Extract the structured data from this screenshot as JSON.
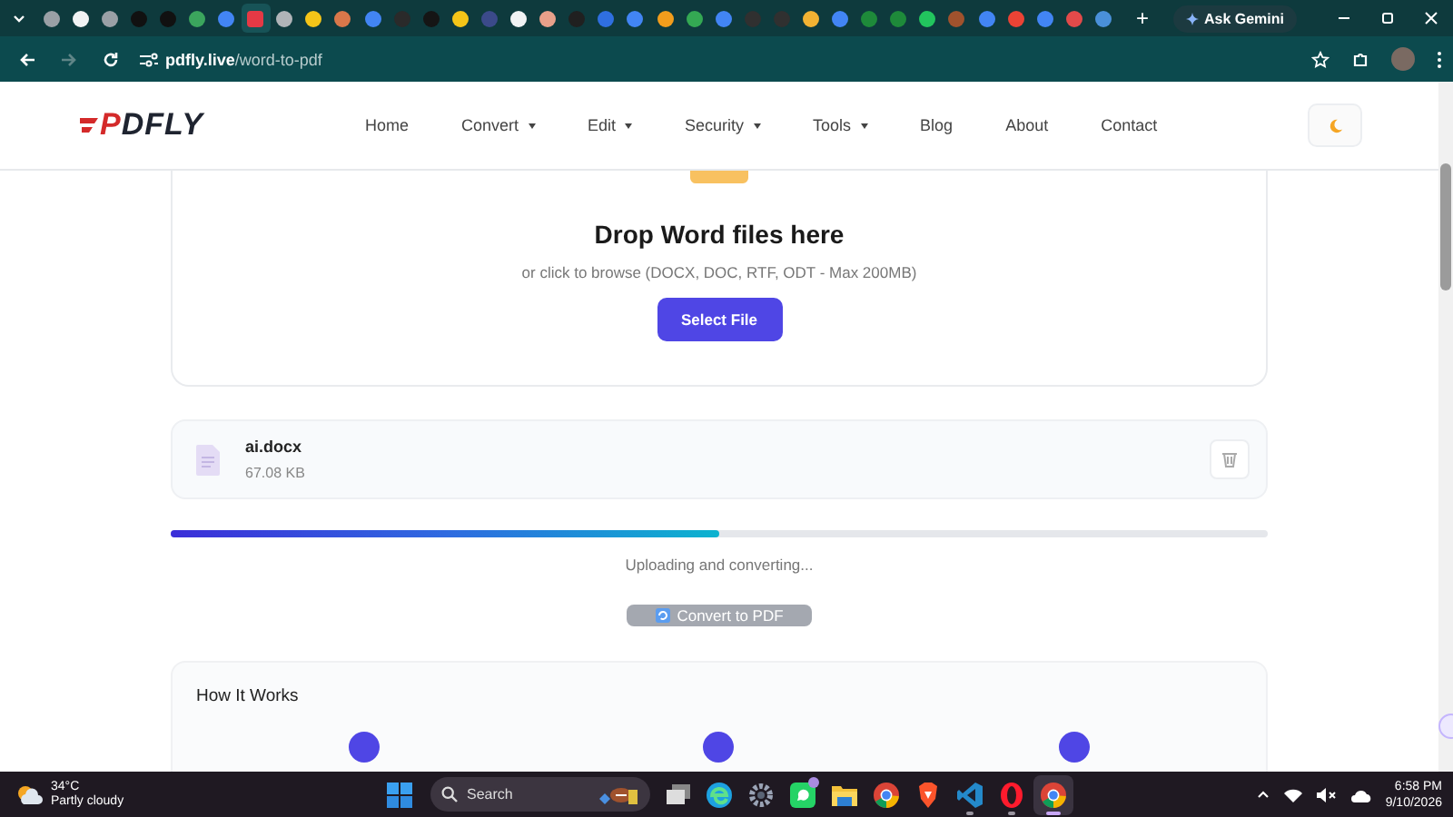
{
  "browser": {
    "tabs": [
      {
        "color": "#9aa0a6",
        "selected": false
      },
      {
        "color": "#f1f3f4",
        "selected": false
      },
      {
        "color": "#9aa0a6",
        "selected": false
      },
      {
        "color": "#111111",
        "selected": false
      },
      {
        "color": "#111111",
        "selected": false
      },
      {
        "color": "#3ba55d",
        "selected": false
      },
      {
        "color": "#4285f4",
        "selected": false
      },
      {
        "color": "#e53945",
        "selected": true
      },
      {
        "color": "#b0b4b8",
        "selected": false
      },
      {
        "color": "#f5c518",
        "selected": false
      },
      {
        "color": "#d9774a",
        "selected": false
      },
      {
        "color": "#4285f4",
        "selected": false
      },
      {
        "color": "#2a2a2a",
        "selected": false
      },
      {
        "color": "#151515",
        "selected": false
      },
      {
        "color": "#f5c518",
        "selected": false
      },
      {
        "color": "#3b4a8a",
        "selected": false
      },
      {
        "color": "#f1f3f4",
        "selected": false
      },
      {
        "color": "#e8a08a",
        "selected": false
      },
      {
        "color": "#202020",
        "selected": false
      },
      {
        "color": "#2f6fe0",
        "selected": false
      },
      {
        "color": "#4285f4",
        "selected": false
      },
      {
        "color": "#f29d1c",
        "selected": false
      },
      {
        "color": "#34a853",
        "selected": false
      },
      {
        "color": "#4285f4",
        "selected": false
      },
      {
        "color": "#303030",
        "selected": false
      },
      {
        "color": "#303030",
        "selected": false
      },
      {
        "color": "#f2b233",
        "selected": false
      },
      {
        "color": "#4285f4",
        "selected": false
      },
      {
        "color": "#1e8a3a",
        "selected": false
      },
      {
        "color": "#1e8a3a",
        "selected": false
      },
      {
        "color": "#22c55e",
        "selected": false
      },
      {
        "color": "#a0522d",
        "selected": false
      },
      {
        "color": "#4285f4",
        "selected": false
      },
      {
        "color": "#ea4335",
        "selected": false
      },
      {
        "color": "#4285f4",
        "selected": false
      },
      {
        "color": "#e24a4a",
        "selected": false
      },
      {
        "color": "#4a90d9",
        "selected": false
      }
    ],
    "new_tab": "+",
    "ask_button": "Ask Gemini",
    "url_host": "pdfly.live",
    "url_path": "/word-to-pdf"
  },
  "header": {
    "logo": "PDFLY",
    "nav": [
      {
        "label": "Home",
        "dropdown": false
      },
      {
        "label": "Convert",
        "dropdown": true
      },
      {
        "label": "Edit",
        "dropdown": true
      },
      {
        "label": "Security",
        "dropdown": true
      },
      {
        "label": "Tools",
        "dropdown": true
      },
      {
        "label": "Blog",
        "dropdown": false
      },
      {
        "label": "About",
        "dropdown": false
      },
      {
        "label": "Contact",
        "dropdown": false
      }
    ]
  },
  "upload": {
    "title": "Drop Word files here",
    "subtitle": "or click to browse (DOCX, DOC, RTF, ODT - Max 200MB)",
    "button": "Select File"
  },
  "file": {
    "name": "ai.docx",
    "size": "67.08 KB"
  },
  "progress": {
    "level": 0.5,
    "status": "Uploading and converting..."
  },
  "convert_button": {
    "label": "Convert to PDF",
    "disabled": true
  },
  "how_it_works": {
    "title": "How It Works",
    "steps": [
      {
        "kind": "step"
      },
      {
        "kind": "step"
      },
      {
        "kind": "step"
      }
    ]
  },
  "taskbar": {
    "weather": {
      "temperature": "34°C",
      "condition": "Partly cloudy"
    },
    "search": {
      "placeholder": "Search"
    },
    "apps": [
      {
        "kind": "start",
        "running": false,
        "selected": false,
        "badge": false
      },
      {
        "kind": "taskview",
        "running": false,
        "selected": false,
        "badge": false
      },
      {
        "kind": "edge",
        "running": false,
        "selected": false,
        "badge": false
      },
      {
        "kind": "settings",
        "running": false,
        "selected": false,
        "badge": false
      },
      {
        "kind": "whatsapp",
        "running": false,
        "selected": false,
        "badge": true
      },
      {
        "kind": "files",
        "running": false,
        "selected": false,
        "badge": false
      },
      {
        "kind": "chrome",
        "running": false,
        "selected": false,
        "badge": false
      },
      {
        "kind": "brave",
        "running": false,
        "selected": false,
        "badge": false
      },
      {
        "kind": "vscode",
        "running": true,
        "selected": false,
        "badge": false
      },
      {
        "kind": "opera",
        "running": true,
        "selected": false,
        "badge": false
      },
      {
        "kind": "chrome",
        "running": true,
        "selected": true,
        "badge": false
      }
    ],
    "time": "6:58 PM",
    "date": "9/10/2026"
  }
}
